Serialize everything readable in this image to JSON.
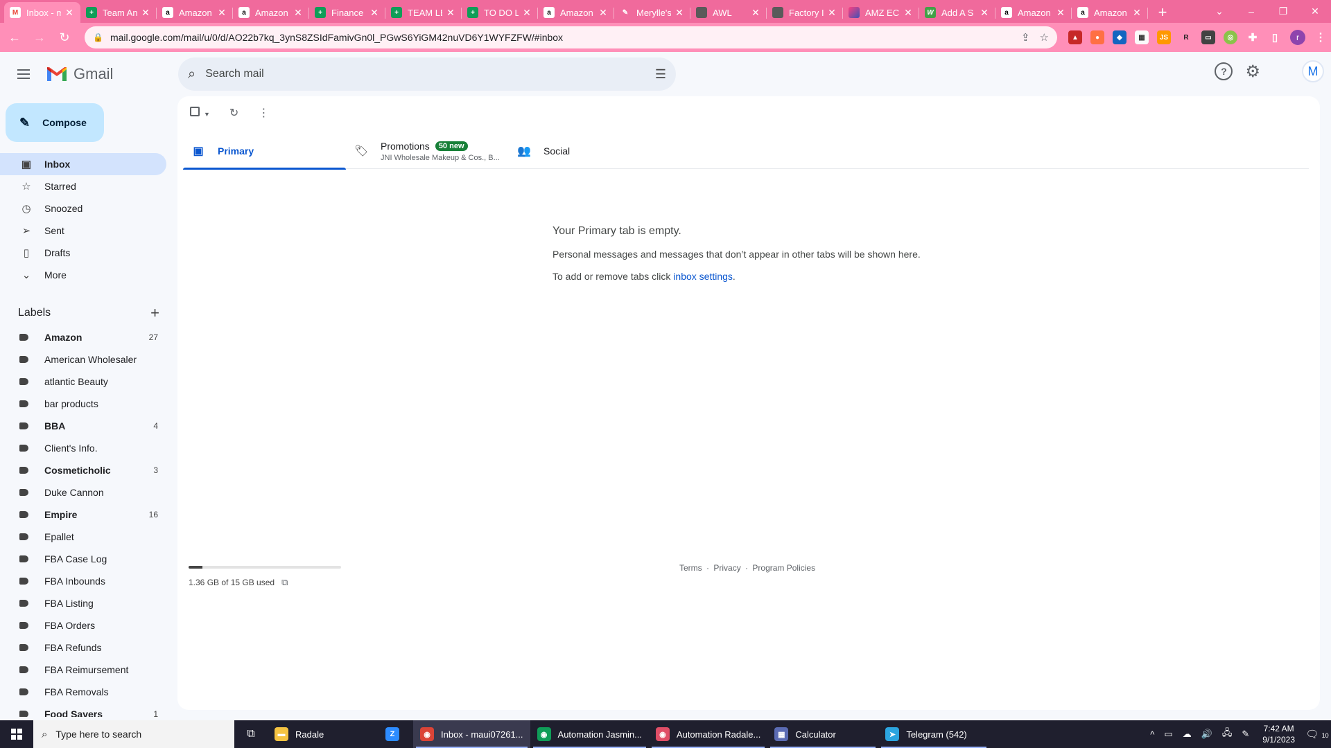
{
  "browser": {
    "tabs": [
      {
        "title": "Inbox - m",
        "favicon": "gmail-icon",
        "active": true
      },
      {
        "title": "Team An",
        "favicon": "sheets-icon"
      },
      {
        "title": "Amazon",
        "favicon": "amazon-icon"
      },
      {
        "title": "Amazon",
        "favicon": "amazon-icon"
      },
      {
        "title": "Finance",
        "favicon": "sheets-icon"
      },
      {
        "title": "TEAM LE",
        "favicon": "sheets-icon"
      },
      {
        "title": "TO DO L",
        "favicon": "sheets-icon"
      },
      {
        "title": "Amazon",
        "favicon": "amazon-icon"
      },
      {
        "title": "Merylle's",
        "favicon": "workflow-icon"
      },
      {
        "title": "AWL",
        "favicon": "github-icon"
      },
      {
        "title": "Factory I",
        "favicon": "github-icon"
      },
      {
        "title": "AMZ EC",
        "favicon": "amz-icon"
      },
      {
        "title": "Add A S",
        "favicon": "w-icon"
      },
      {
        "title": "Amazon",
        "favicon": "amazon-icon"
      },
      {
        "title": "Amazon",
        "favicon": "amazon-icon"
      }
    ],
    "url": "mail.google.com/mail/u/0/d/AO22b7kq_3ynS8ZSIdFamivGn0l_PGwS6YiGM42nuVD6Y1WYFZFW/#inbox",
    "profile_initial": "r"
  },
  "gmail": {
    "app_name": "Gmail",
    "search_placeholder": "Search mail",
    "account_initial": "M",
    "compose_label": "Compose",
    "nav": [
      {
        "label": "Inbox",
        "icon": "inbox-icon",
        "active": true
      },
      {
        "label": "Starred",
        "icon": "star-icon"
      },
      {
        "label": "Snoozed",
        "icon": "clock-icon"
      },
      {
        "label": "Sent",
        "icon": "send-icon"
      },
      {
        "label": "Drafts",
        "icon": "draft-icon"
      },
      {
        "label": "More",
        "icon": "chevron-down-icon"
      }
    ],
    "labels_heading": "Labels",
    "labels": [
      {
        "name": "Amazon",
        "count": "27",
        "bold": true
      },
      {
        "name": "American Wholesaler",
        "count": "",
        "bold": false
      },
      {
        "name": "atlantic Beauty",
        "count": "",
        "bold": false
      },
      {
        "name": "bar products",
        "count": "",
        "bold": false
      },
      {
        "name": "BBA",
        "count": "4",
        "bold": true
      },
      {
        "name": "Client's Info.",
        "count": "",
        "bold": false
      },
      {
        "name": "Cosmeticholic",
        "count": "3",
        "bold": true
      },
      {
        "name": "Duke Cannon",
        "count": "",
        "bold": false
      },
      {
        "name": "Empire",
        "count": "16",
        "bold": true
      },
      {
        "name": "Epallet",
        "count": "",
        "bold": false
      },
      {
        "name": "FBA Case Log",
        "count": "",
        "bold": false
      },
      {
        "name": "FBA Inbounds",
        "count": "",
        "bold": false
      },
      {
        "name": "FBA Listing",
        "count": "",
        "bold": false
      },
      {
        "name": "FBA Orders",
        "count": "",
        "bold": false
      },
      {
        "name": "FBA Refunds",
        "count": "",
        "bold": false
      },
      {
        "name": "FBA Reimursement",
        "count": "",
        "bold": false
      },
      {
        "name": "FBA Removals",
        "count": "",
        "bold": false
      },
      {
        "name": "Food Savers",
        "count": "1",
        "bold": true
      }
    ],
    "tabs": {
      "primary": "Primary",
      "promotions": "Promotions",
      "promotions_badge": "50 new",
      "promotions_snippet": "JNI Wholesale Makeup & Cos., B...",
      "social": "Social"
    },
    "empty_state": {
      "title": "Your Primary tab is empty.",
      "line1": "Personal messages and messages that don’t appear in other tabs will be shown here.",
      "line2_prefix": "To add or remove tabs click ",
      "line2_link": "inbox settings",
      "line2_suffix": "."
    },
    "storage": {
      "text": "1.36 GB of 15 GB used",
      "fraction": 0.09
    },
    "footer": {
      "terms": "Terms",
      "privacy": "Privacy",
      "policies": "Program Policies",
      "separator": "·"
    }
  },
  "taskbar": {
    "search_placeholder": "Type here to search",
    "apps": [
      {
        "label": "Radale",
        "icon": "folder-icon",
        "color": "#f5c342"
      },
      {
        "label": "",
        "icon": "zoom-icon",
        "color": "#2d8cff"
      },
      {
        "label": "Inbox - maui07261...",
        "icon": "chrome-icon",
        "color": "#db4437"
      },
      {
        "label": "Automation Jasmin...",
        "icon": "chrome-icon",
        "color": "#0f9d58"
      },
      {
        "label": "Automation Radale...",
        "icon": "chrome-icon",
        "color": "#e04e67"
      },
      {
        "label": "Calculator",
        "icon": "calculator-icon",
        "color": "#5b6bb3"
      },
      {
        "label": "Telegram (542)",
        "icon": "telegram-icon",
        "color": "#2ca5e0"
      }
    ],
    "time": "7:42 AM",
    "date": "9/1/2023",
    "notification_count": "10"
  }
}
